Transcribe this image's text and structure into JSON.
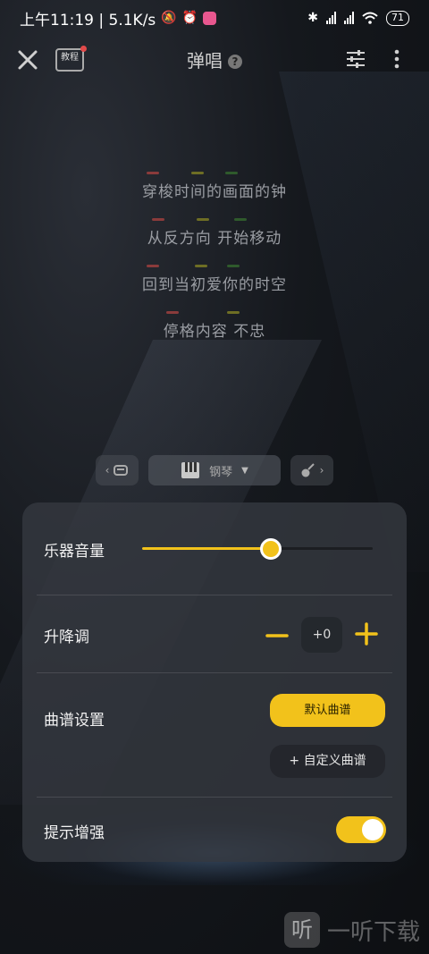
{
  "status_bar": {
    "time_and_speed": "上午11:19 | 5.1K/s",
    "battery": "71"
  },
  "header": {
    "tutorial_label": "教程",
    "title": "弹唱",
    "help_glyph": "?"
  },
  "lyrics": [
    "穿梭时间的画面的钟",
    "从反方向 开始移动",
    "回到当初爱你的时空",
    "停格内容 不忠"
  ],
  "instrument_switcher": {
    "current": "钢琴"
  },
  "settings": {
    "volume": {
      "label": "乐器音量",
      "level": 0.56
    },
    "transpose": {
      "label": "升降调",
      "value": "+0"
    },
    "score": {
      "label": "曲谱设置",
      "default_button": "默认曲谱",
      "custom_button": "+ 自定义曲谱"
    },
    "hint": {
      "label": "提示增强",
      "enabled": true
    }
  },
  "colors": {
    "accent": "#f2c21b",
    "marker_red": "#c0504d",
    "marker_olive": "#8a8a2a",
    "marker_green": "#3f6e3a"
  },
  "watermark": {
    "logo_glyph": "听",
    "text": "一听下载"
  }
}
